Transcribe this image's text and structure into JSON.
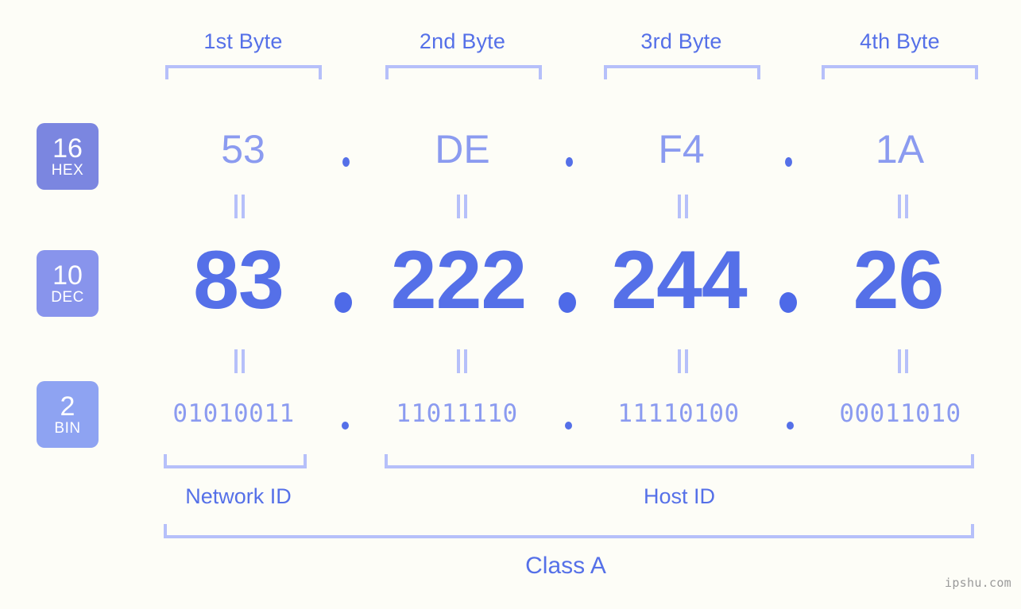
{
  "background_color": "#fdfdf7",
  "accent_color": "#5570e8",
  "light_accent_color": "#8b9bf0",
  "bracket_color": "#b6c0fa",
  "header": {
    "byte_labels": [
      {
        "text": "1st Byte"
      },
      {
        "text": "2nd Byte"
      },
      {
        "text": "3rd Byte"
      },
      {
        "text": "4th Byte"
      }
    ]
  },
  "rows": [
    {
      "id": "hex",
      "badge": {
        "number": "16",
        "name": "HEX",
        "color": "#7b86e0"
      },
      "values": [
        "53",
        "DE",
        "F4",
        "1A"
      ],
      "separator": "."
    },
    {
      "id": "dec",
      "badge": {
        "number": "10",
        "name": "DEC",
        "color": "#8894ec"
      },
      "values": [
        "83",
        "222",
        "244",
        "26"
      ],
      "separator": "."
    },
    {
      "id": "bin",
      "badge": {
        "number": "2",
        "name": "BIN",
        "color": "#8ea3f2"
      },
      "values": [
        "01010011",
        "11011110",
        "11110100",
        "00011010"
      ],
      "separator": "."
    }
  ],
  "equals_marker": "=",
  "footer": {
    "network_id_label": "Network ID",
    "host_id_label": "Host ID",
    "class_label": "Class A"
  },
  "watermark": "ipshu.com"
}
